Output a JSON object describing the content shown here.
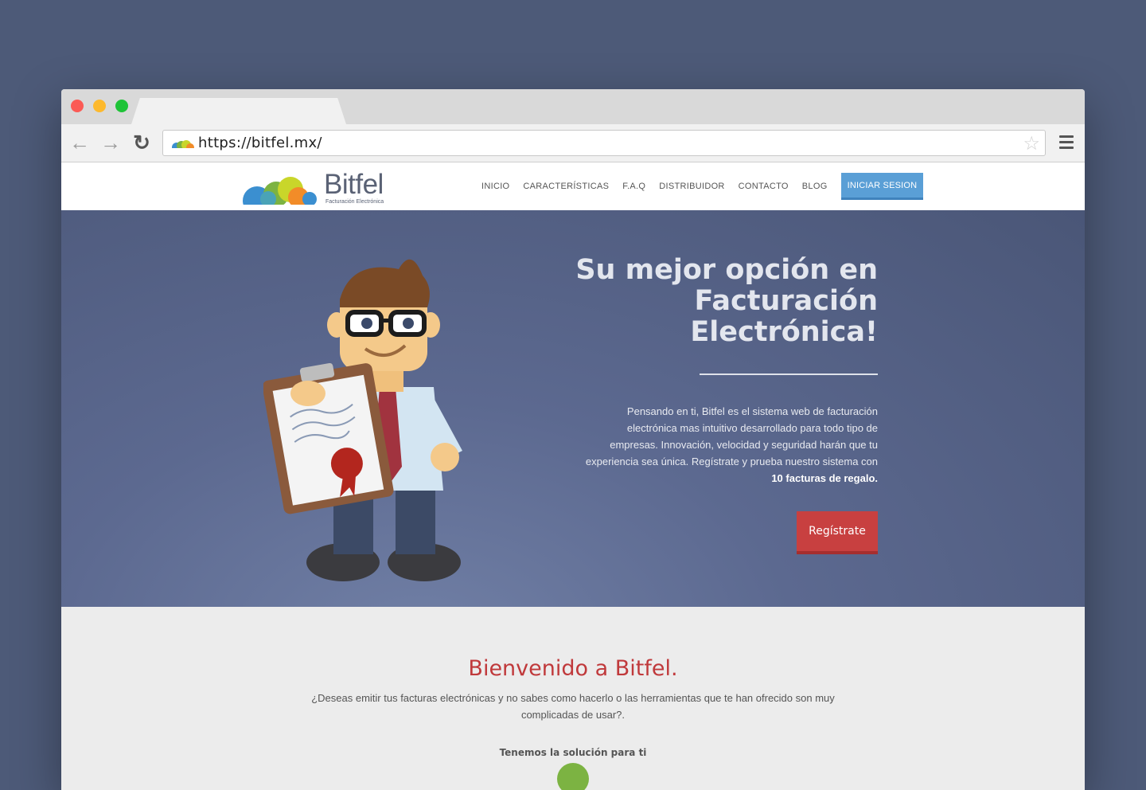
{
  "browser": {
    "url": "https://bitfel.mx/",
    "back_icon": "arrow-left-icon",
    "forward_icon": "arrow-right-icon",
    "reload_icon": "reload-icon",
    "bookmark_icon": "star-icon",
    "menu_icon": "hamburger-menu-icon"
  },
  "site": {
    "logo_name": "Bitfel",
    "logo_tagline": "Facturación Electrónica",
    "nav": [
      "INICIO",
      "CARACTERÍSTICAS",
      "F.A.Q",
      "DISTRIBUIDOR",
      "CONTACTO",
      "BLOG"
    ],
    "login_label": "INICIAR SESION",
    "accent": "#5a9fd6",
    "brand_red": "#c84040"
  },
  "hero": {
    "title_line1": "Su mejor opción en",
    "title_line2": "Facturación",
    "title_line3": "Electrónica!",
    "body": "Pensando en ti, Bitfel es el sistema web de facturación electrónica mas intuitivo desarrollado para todo tipo de empresas. Innovación, velocidad y seguridad harán que tu experiencia sea única. Regístrate y prueba nuestro sistema con ",
    "body_bold": "10 facturas de regalo.",
    "cta_label": "Regístrate"
  },
  "welcome": {
    "title": "Bienvenido a Bitfel.",
    "text": "¿Deseas emitir tus facturas electrónicas y no sabes como hacerlo o las herramientas que te han ofrecido son muy complicadas de usar?.",
    "subtitle": "Tenemos la solución para ti"
  }
}
